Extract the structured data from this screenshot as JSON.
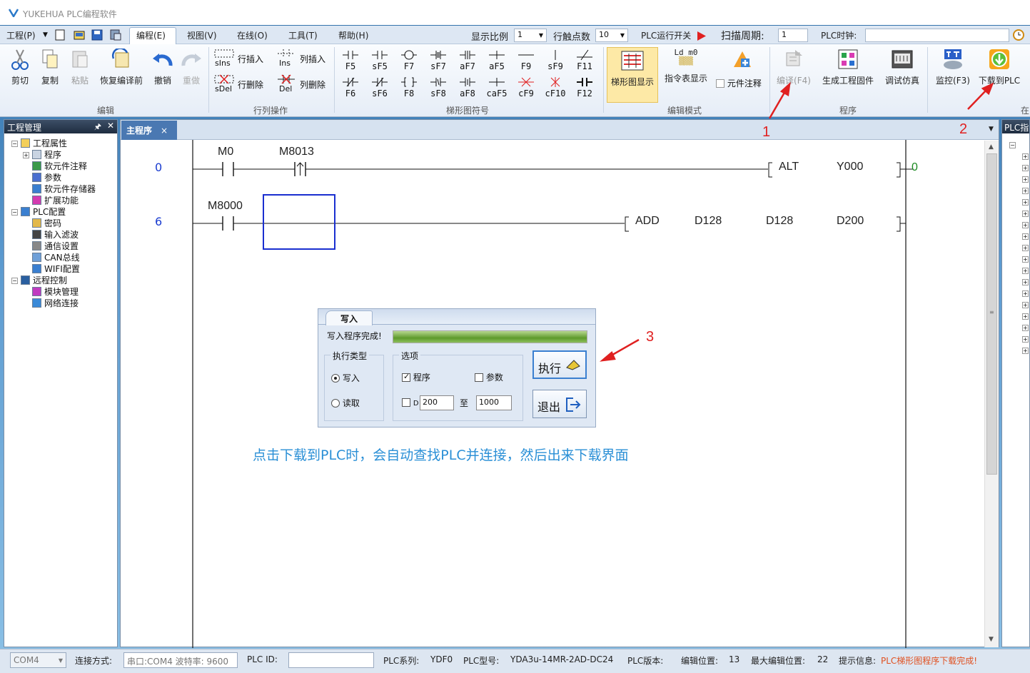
{
  "app": {
    "title": "YUKEHUA PLC编程软件"
  },
  "menu": {
    "items": [
      "工程(P)",
      "编程(E)",
      "视图(V)",
      "在线(O)",
      "工具(T)",
      "帮助(H)"
    ],
    "scale_label": "显示比例",
    "scale_value": "1",
    "row_points_label": "行触点数",
    "row_points_value": "10",
    "plc_run_label": "PLC运行开关",
    "scan_label": "扫描周期:",
    "scan_value": "1",
    "clock_label": "PLC时钟:"
  },
  "ribbon": {
    "edit": {
      "cut": "剪切",
      "copy": "复制",
      "paste": "粘贴",
      "restore": "恢复编译前",
      "undo": "撤销",
      "redo": "重做",
      "group": "编辑"
    },
    "rowcol": {
      "row_insert": "行插入",
      "col_insert": "列插入",
      "row_delete": "行删除",
      "col_delete": "列删除",
      "sins": "sIns",
      "ins": "Ins",
      "sdel": "sDel",
      "del": "Del",
      "group": "行列操作"
    },
    "symbols": {
      "row1": [
        "F5",
        "sF5",
        "F7",
        "sF7",
        "aF7",
        "aF5",
        "F9",
        "sF9",
        "F11"
      ],
      "row2": [
        "F6",
        "sF6",
        "F8",
        "sF8",
        "aF8",
        "caF5",
        "cF9",
        "cF10",
        "F12"
      ],
      "group": "梯形图符号"
    },
    "mode": {
      "ladder": "梯形图显示",
      "instr": "指令表显示",
      "instr_icon": "Ld m0",
      "comment": "元件注释",
      "group": "编辑模式"
    },
    "program": {
      "compile": "编译(F4)",
      "firmware": "生成工程固件",
      "debug": "调试仿真",
      "group": "程序"
    },
    "online": {
      "monitor": "监控(F3)",
      "download": "下载到PLC",
      "group": "在"
    }
  },
  "project_panel": {
    "title": "工程管理",
    "tree": [
      "工程属性",
      "程序",
      "软元件注释",
      "参数",
      "软元件存储器",
      "扩展功能",
      "PLC配置",
      "密码",
      "输入滤波",
      "通信设置",
      "CAN总线",
      "WIFI配置",
      "远程控制",
      "模块管理",
      "网络连接"
    ]
  },
  "editor": {
    "tab": "主程序",
    "rung1": {
      "step": "0",
      "contact1": "M0",
      "contact2": "M8013",
      "instr": "ALT",
      "op1": "Y000",
      "end": "0"
    },
    "rung2": {
      "step": "6",
      "contact1": "M8000",
      "instr": "ADD",
      "op1": "D128",
      "op2": "D128",
      "op3": "D200"
    },
    "note": "点击下载到PLC时，会自动查找PLC并连接，然后出来下载界面"
  },
  "right_panel": {
    "title": "PLC指令"
  },
  "dialog": {
    "tab": "写入",
    "status": "写入程序完成!",
    "progress": 1.0,
    "exec_type_label": "执行类型",
    "write": "写入",
    "read": "读取",
    "options_label": "选项",
    "program": "程序",
    "params": "参数",
    "d_label": "D",
    "d_from": "200",
    "to": "至",
    "d_to": "1000",
    "exec_btn": "执行",
    "exit_btn": "退出"
  },
  "annotations": {
    "n1": "1",
    "n2": "2",
    "n3": "3"
  },
  "status": {
    "port": "COM4",
    "conn_label": "连接方式:",
    "conn_value": "串口:COM4 波特率: 9600",
    "plc_id_label": "PLC ID:",
    "series_label": "PLC系列:",
    "series_value": "YDF0",
    "model_label": "PLC型号:",
    "model_value": "YDA3u-14MR-2AD-DC24",
    "version_label": "PLC版本:",
    "pos_label": "编辑位置:",
    "pos_value": "13",
    "max_label": "最大编辑位置:",
    "max_value": "22",
    "hint_label": "提示信息:",
    "hint_value": "PLC梯形图程序下载完成!"
  },
  "colors": {
    "accent": "#1a3cd0",
    "annotation": "#e02020",
    "note": "#2a8fd6",
    "hint": "#e05020"
  }
}
